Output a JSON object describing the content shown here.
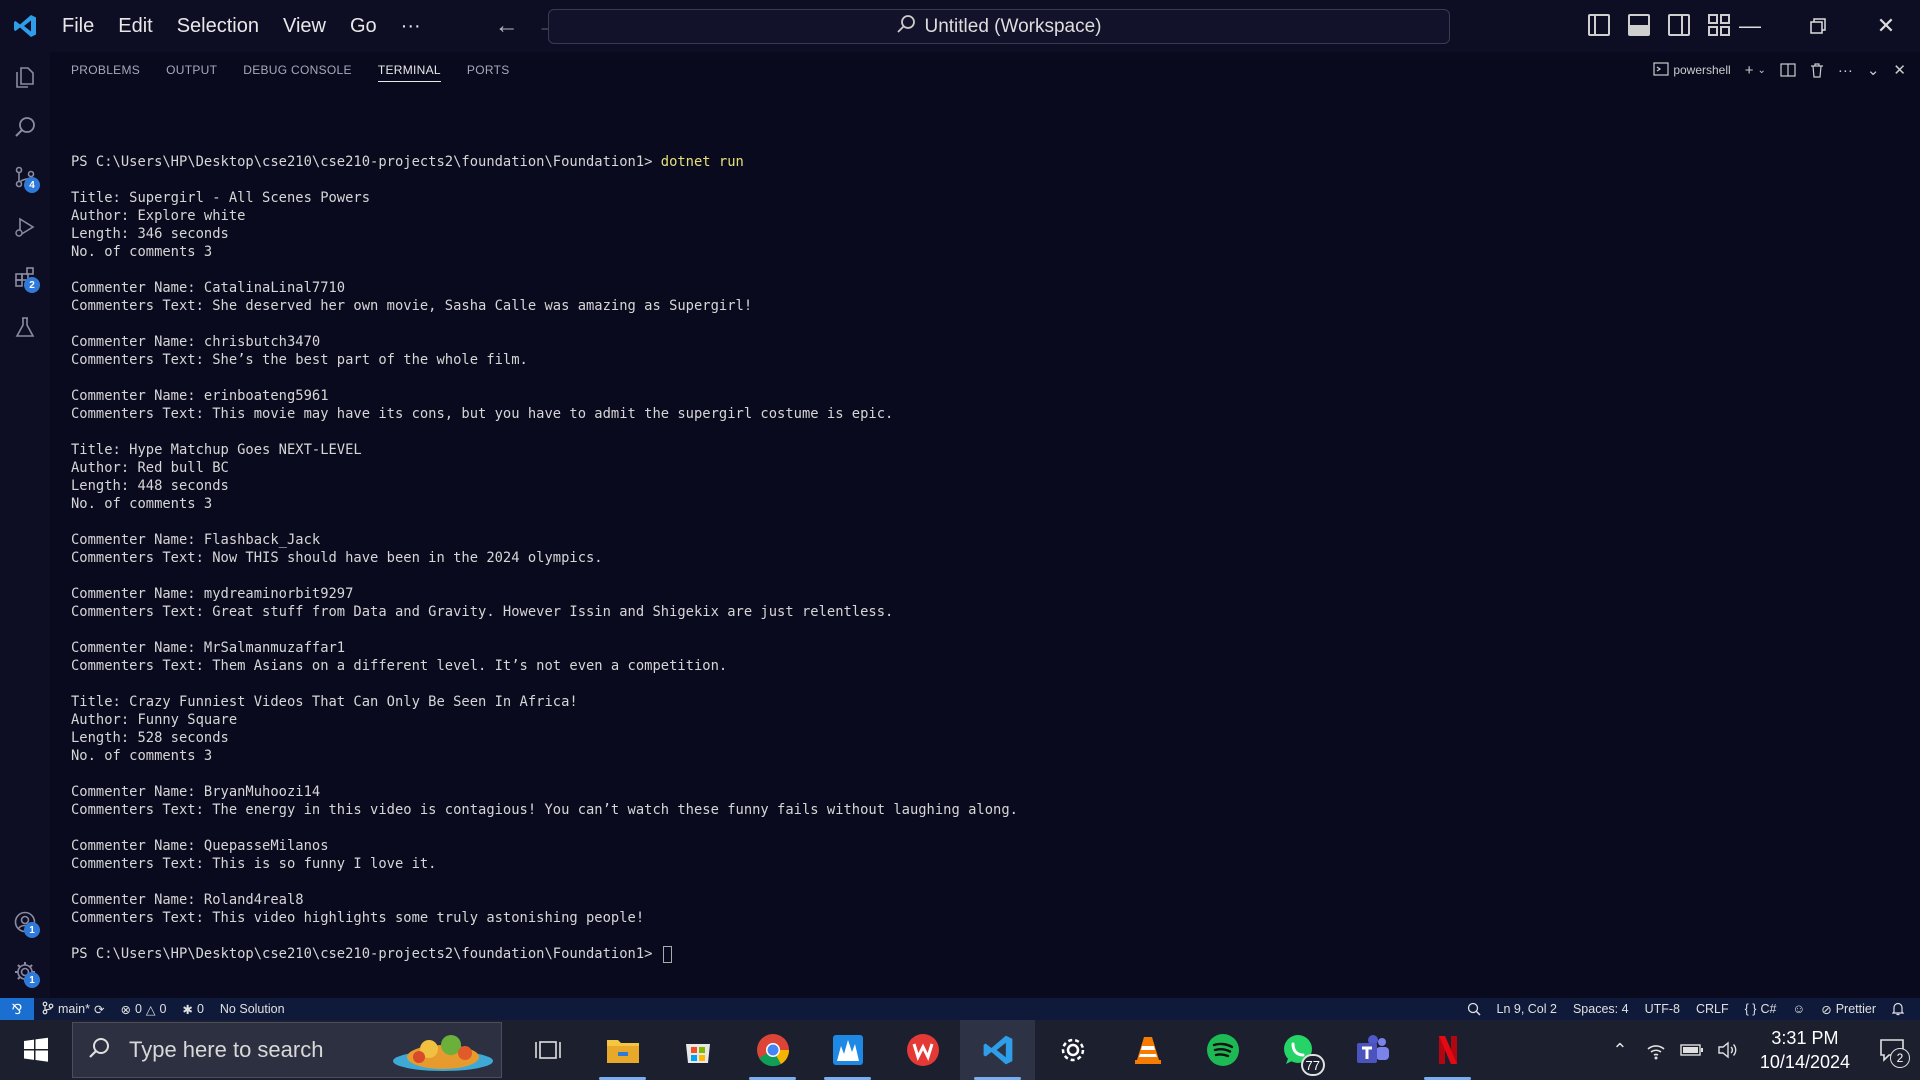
{
  "titlebar": {
    "menu": [
      "File",
      "Edit",
      "Selection",
      "View",
      "Go",
      "···"
    ],
    "workspace_title": "Untitled (Workspace)"
  },
  "activitybar": {
    "source_control_badge": "4",
    "extensions_badge": "2",
    "accounts_badge": "1",
    "settings_badge": "1"
  },
  "panel": {
    "tabs": [
      "PROBLEMS",
      "OUTPUT",
      "DEBUG CONSOLE",
      "TERMINAL",
      "PORTS"
    ],
    "active_tab": "TERMINAL",
    "terminal_profile": "powershell"
  },
  "terminal": {
    "prompt": "PS C:\\Users\\HP\\Desktop\\cse210\\cse210-projects2\\foundation\\Foundation1> ",
    "command": "dotnet run",
    "lines": [
      "",
      "Title: Supergirl - All Scenes Powers",
      "Author: Explore white",
      "Length: 346 seconds",
      "No. of comments 3",
      "",
      "Commenter Name: CatalinaLinal7710",
      "Commenters Text: She deserved her own movie, Sasha Calle was amazing as Supergirl!",
      "",
      "Commenter Name: chrisbutch3470",
      "Commenters Text: She’s the best part of the whole film.",
      "",
      "Commenter Name: erinboateng5961",
      "Commenters Text: This movie may have its cons, but you have to admit the supergirl costume is epic.",
      "",
      "Title: Hype Matchup Goes NEXT-LEVEL",
      "Author: Red bull BC",
      "Length: 448 seconds",
      "No. of comments 3",
      "",
      "Commenter Name: Flashback_Jack",
      "Commenters Text: Now THIS should have been in the 2024 olympics.",
      "",
      "Commenter Name: mydreaminorbit9297",
      "Commenters Text: Great stuff from Data and Gravity. However Issin and Shigekix are just relentless.",
      "",
      "Commenter Name: MrSalmanmuzaffar1",
      "Commenters Text: Them Asians on a different level. It’s not even a competition.",
      "",
      "Title: Crazy Funniest Videos That Can Only Be Seen In Africa!",
      "Author: Funny Square",
      "Length: 528 seconds",
      "No. of comments 3",
      "",
      "Commenter Name: BryanMuhoozi14",
      "Commenters Text: The energy in this video is contagious! You can’t watch these funny fails without laughing along.",
      "",
      "Commenter Name: QuepasseMilanos",
      "Commenters Text: This is so funny I love it.",
      "",
      "Commenter Name: Roland4real8",
      "Commenters Text: This video highlights some truly astonishing people!",
      ""
    ],
    "final_prompt": "PS C:\\Users\\HP\\Desktop\\cse210\\cse210-projects2\\foundation\\Foundation1> "
  },
  "statusbar": {
    "branch": "main*",
    "errors": "0",
    "warnings": "0",
    "ports": "0",
    "solution": "No Solution",
    "cursor_pos": "Ln 9, Col 2",
    "spaces": "Spaces: 4",
    "encoding": "UTF-8",
    "eol": "CRLF",
    "language": "C#",
    "formatter": "Prettier"
  },
  "taskbar": {
    "search_placeholder": "Type here to search",
    "whatsapp_badge": "77",
    "time": "3:31 PM",
    "date": "10/14/2024",
    "notification_count": "2"
  },
  "colors": {
    "accent": "#1b6fd0",
    "terminal_bg": "#0a0a1e",
    "command_yellow": "#e5e07a"
  }
}
